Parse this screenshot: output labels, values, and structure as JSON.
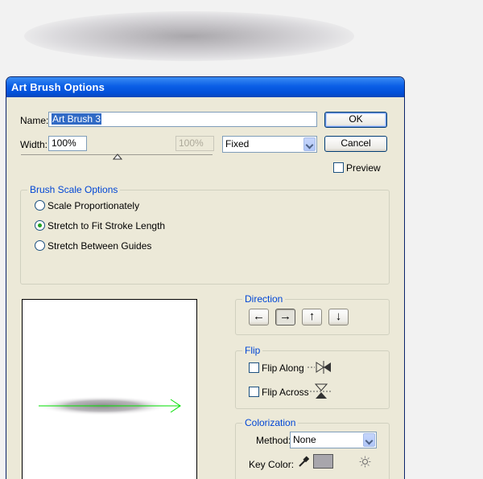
{
  "dialog": {
    "title": "Art Brush Options"
  },
  "name_field": {
    "label": "Name:",
    "value": "Art Brush 3"
  },
  "width_field": {
    "label": "Width:",
    "value": "100%",
    "disabled_value": "100%",
    "mode": "Fixed"
  },
  "buttons": {
    "ok": "OK",
    "cancel": "Cancel"
  },
  "preview_toggle": {
    "label": "Preview",
    "checked": false
  },
  "brush_scale": {
    "title": "Brush Scale Options",
    "options": [
      {
        "label": "Scale Proportionately",
        "checked": false
      },
      {
        "label": "Stretch to Fit Stroke Length",
        "checked": true
      },
      {
        "label": "Stretch Between Guides",
        "checked": false
      }
    ]
  },
  "direction": {
    "title": "Direction",
    "buttons": [
      "←",
      "→",
      "↑",
      "↓"
    ],
    "selected": 1
  },
  "flip": {
    "title": "Flip",
    "along": "Flip Along",
    "across": "Flip Across"
  },
  "colorization": {
    "title": "Colorization",
    "method_label": "Method:",
    "method_value": "None",
    "key_color_label": "Key Color:"
  },
  "colors": {
    "title_bar": "#0a5ee6",
    "accent_text": "#0046d5",
    "preview_arrow": "#00e000",
    "key_swatch": "#a8a6ac"
  },
  "icons": {
    "eyedropper": "eyedropper-icon",
    "tips": "tips-icon"
  }
}
